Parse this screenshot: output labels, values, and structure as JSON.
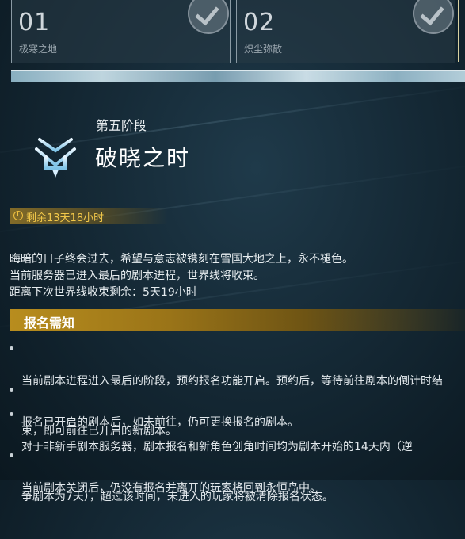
{
  "stages": [
    {
      "number": "01",
      "name": "极寒之地",
      "completed": true
    },
    {
      "number": "02",
      "name": "炽尘弥散",
      "completed": true
    }
  ],
  "current_stage": {
    "label": "第五阶段",
    "title": "破晓之时",
    "emblem_icon": "rune-emblem-icon"
  },
  "timer": {
    "text": "剩余13天18小时",
    "icon": "clock-icon"
  },
  "intro_lines": [
    "晦暗的日子终会过去，希望与意志被镌刻在雪国大地之上，永不褪色。",
    "当前服务器已进入最后的剧本进程，世界线将收束。",
    "距离下次世界线收束剩余：5天19小时"
  ],
  "notice": {
    "header": "报名需知",
    "items": [
      {
        "lines": [
          "当前剧本进程进入最后的阶段，预约报名功能开启。预约后，等待前往剧本的倒计时结",
          "束，即可前往已开启的新剧本。"
        ]
      },
      {
        "lines": [
          "报名已开启的剧本后，如未前往，仍可更换报名的剧本。"
        ]
      },
      {
        "lines": [
          "对于非新手剧本服务器，剧本报名和新角色创角时间均为剧本开始的14天内（逆",
          "争剧本为7天），超过该时间，未进入的玩家将被清除报名状态。"
        ]
      },
      {
        "lines": [
          "当前剧本关闭后，仍没有报名并离开的玩家将回到永恒岛中。"
        ]
      }
    ]
  },
  "colors": {
    "accent_gold": "#b88d1e",
    "timer_text": "#f2c84a",
    "ice": "#c8dfe8"
  }
}
